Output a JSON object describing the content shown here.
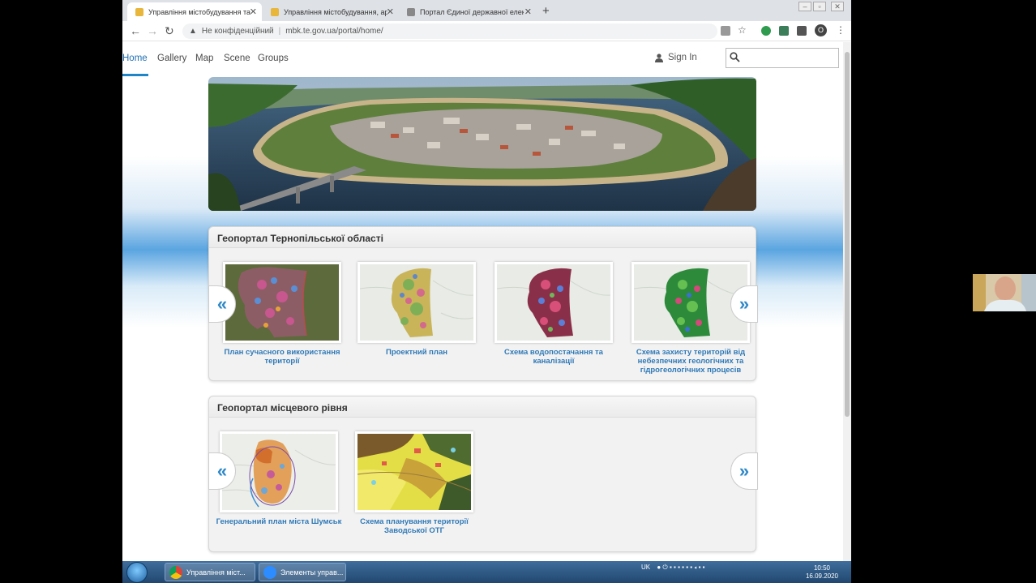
{
  "browser": {
    "tabs": [
      {
        "label": "Управління містобудування та а",
        "active": true
      },
      {
        "label": "Управління містобудування, ар",
        "active": false
      },
      {
        "label": "Портал Єдиної державної елек",
        "active": false
      }
    ],
    "new_tab_label": "+",
    "address": {
      "security_label": "Не конфіденційний",
      "url": "mbk.te.gov.ua/portal/home/"
    },
    "profile_initial": "O"
  },
  "site_nav": {
    "links": [
      "Home",
      "Gallery",
      "Map",
      "Scene",
      "Groups"
    ],
    "active_link": "Home",
    "sign_in_label": "Sign In",
    "search_placeholder": ""
  },
  "sections": [
    {
      "title": "Геопортал Тернопільської області",
      "items": [
        {
          "title": "План сучасного використання території",
          "icon": "map-thumbnail-satellite"
        },
        {
          "title": "Проектний план",
          "icon": "map-thumbnail-plan"
        },
        {
          "title": "Схема водопостачання та каналізації",
          "icon": "map-thumbnail-water"
        },
        {
          "title": "Схема захисту територій від небезпечних геологічних та гідрогеологічних процесів",
          "icon": "map-thumbnail-geology"
        }
      ]
    },
    {
      "title": "Геопортал місцевого рівня",
      "items": [
        {
          "title": "Генеральний план міста Шумськ",
          "icon": "map-thumbnail-city"
        },
        {
          "title": "Схема планування території Заводської ОТГ",
          "icon": "map-thumbnail-territory"
        }
      ]
    }
  ],
  "carousel": {
    "prev_glyph": "«",
    "next_glyph": "»"
  },
  "taskbar": {
    "items": [
      "Управління міст...",
      "Элементы управ..."
    ],
    "language": "UK",
    "time": "10:50",
    "date": "16.09.2020"
  },
  "colors": {
    "accent": "#2f79b7",
    "nav_underline": "#1f84c8"
  }
}
